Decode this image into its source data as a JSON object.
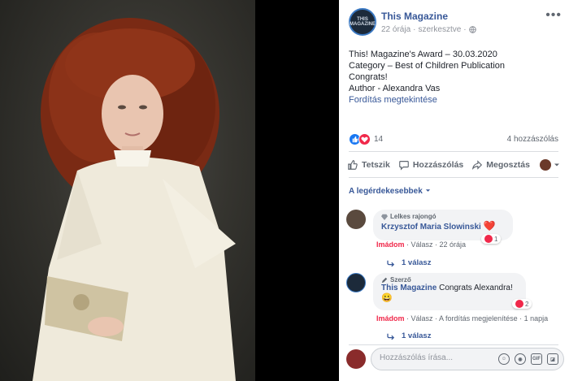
{
  "post": {
    "page_name": "This Magazine",
    "time": "22 órája",
    "edited": "szerkesztve",
    "avatar_text": "THIS MAGAZINE",
    "lines": [
      "This! Magazine's Award – 30.03.2020",
      "Category – Best of Children Publication",
      "Congrats!",
      "Author - Alexandra Vas"
    ],
    "translate_link": "Fordítás megtekintése",
    "reaction_count": "14",
    "comment_count": "4 hozzászólás"
  },
  "actions": {
    "like": "Tetszik",
    "comment": "Hozzászólás",
    "share": "Megosztás"
  },
  "comments_sort": "A legérdekesebbek",
  "comments": [
    {
      "badge": "Lelkes rajongó",
      "name": "Krzysztof Maria Slowinski",
      "text": "❤️",
      "reaction_count": "1",
      "love": "Imádom",
      "reply": "Válasz",
      "time": "22 órája",
      "replies": "1 válasz"
    },
    {
      "badge": "Szerző",
      "name": "This Magazine",
      "text": "Congrats Alexandra!",
      "emoji": "😀",
      "reaction_count": "2",
      "love": "Imádom",
      "reply": "Válasz",
      "translation": "A fordítás megjelenítése",
      "time": "1 napja",
      "replies": "1 válasz"
    }
  ],
  "composer": {
    "placeholder": "Hozzászólás írása..."
  },
  "colors": {
    "link": "#385898",
    "like_blue": "#1877f2",
    "love_red": "#f0284a"
  }
}
